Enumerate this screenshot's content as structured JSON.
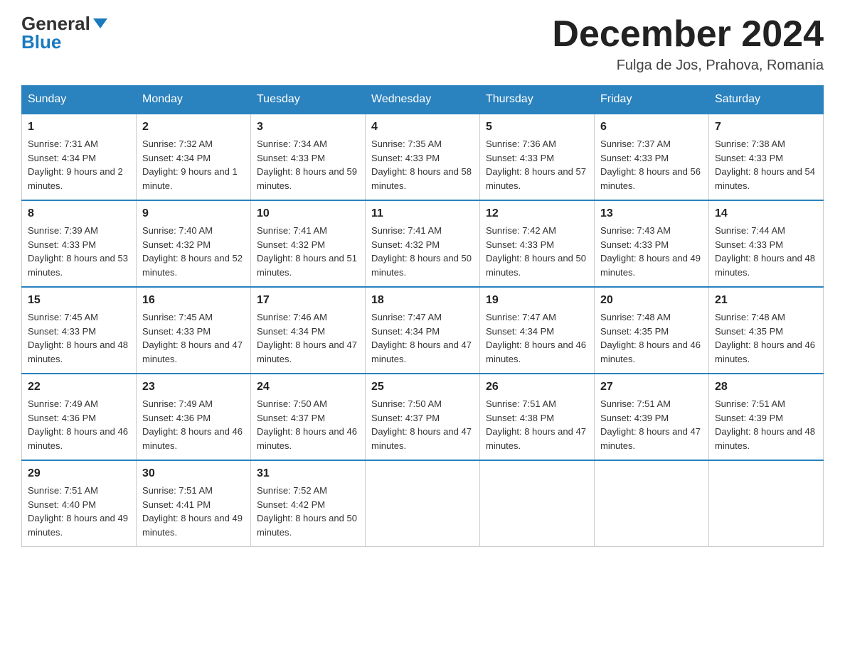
{
  "header": {
    "logo_general": "General",
    "logo_blue": "Blue",
    "month_title": "December 2024",
    "location": "Fulga de Jos, Prahova, Romania"
  },
  "days_of_week": [
    "Sunday",
    "Monday",
    "Tuesday",
    "Wednesday",
    "Thursday",
    "Friday",
    "Saturday"
  ],
  "weeks": [
    [
      {
        "day": "1",
        "sunrise": "7:31 AM",
        "sunset": "4:34 PM",
        "daylight": "9 hours and 2 minutes."
      },
      {
        "day": "2",
        "sunrise": "7:32 AM",
        "sunset": "4:34 PM",
        "daylight": "9 hours and 1 minute."
      },
      {
        "day": "3",
        "sunrise": "7:34 AM",
        "sunset": "4:33 PM",
        "daylight": "8 hours and 59 minutes."
      },
      {
        "day": "4",
        "sunrise": "7:35 AM",
        "sunset": "4:33 PM",
        "daylight": "8 hours and 58 minutes."
      },
      {
        "day": "5",
        "sunrise": "7:36 AM",
        "sunset": "4:33 PM",
        "daylight": "8 hours and 57 minutes."
      },
      {
        "day": "6",
        "sunrise": "7:37 AM",
        "sunset": "4:33 PM",
        "daylight": "8 hours and 56 minutes."
      },
      {
        "day": "7",
        "sunrise": "7:38 AM",
        "sunset": "4:33 PM",
        "daylight": "8 hours and 54 minutes."
      }
    ],
    [
      {
        "day": "8",
        "sunrise": "7:39 AM",
        "sunset": "4:33 PM",
        "daylight": "8 hours and 53 minutes."
      },
      {
        "day": "9",
        "sunrise": "7:40 AM",
        "sunset": "4:32 PM",
        "daylight": "8 hours and 52 minutes."
      },
      {
        "day": "10",
        "sunrise": "7:41 AM",
        "sunset": "4:32 PM",
        "daylight": "8 hours and 51 minutes."
      },
      {
        "day": "11",
        "sunrise": "7:41 AM",
        "sunset": "4:32 PM",
        "daylight": "8 hours and 50 minutes."
      },
      {
        "day": "12",
        "sunrise": "7:42 AM",
        "sunset": "4:33 PM",
        "daylight": "8 hours and 50 minutes."
      },
      {
        "day": "13",
        "sunrise": "7:43 AM",
        "sunset": "4:33 PM",
        "daylight": "8 hours and 49 minutes."
      },
      {
        "day": "14",
        "sunrise": "7:44 AM",
        "sunset": "4:33 PM",
        "daylight": "8 hours and 48 minutes."
      }
    ],
    [
      {
        "day": "15",
        "sunrise": "7:45 AM",
        "sunset": "4:33 PM",
        "daylight": "8 hours and 48 minutes."
      },
      {
        "day": "16",
        "sunrise": "7:45 AM",
        "sunset": "4:33 PM",
        "daylight": "8 hours and 47 minutes."
      },
      {
        "day": "17",
        "sunrise": "7:46 AM",
        "sunset": "4:34 PM",
        "daylight": "8 hours and 47 minutes."
      },
      {
        "day": "18",
        "sunrise": "7:47 AM",
        "sunset": "4:34 PM",
        "daylight": "8 hours and 47 minutes."
      },
      {
        "day": "19",
        "sunrise": "7:47 AM",
        "sunset": "4:34 PM",
        "daylight": "8 hours and 46 minutes."
      },
      {
        "day": "20",
        "sunrise": "7:48 AM",
        "sunset": "4:35 PM",
        "daylight": "8 hours and 46 minutes."
      },
      {
        "day": "21",
        "sunrise": "7:48 AM",
        "sunset": "4:35 PM",
        "daylight": "8 hours and 46 minutes."
      }
    ],
    [
      {
        "day": "22",
        "sunrise": "7:49 AM",
        "sunset": "4:36 PM",
        "daylight": "8 hours and 46 minutes."
      },
      {
        "day": "23",
        "sunrise": "7:49 AM",
        "sunset": "4:36 PM",
        "daylight": "8 hours and 46 minutes."
      },
      {
        "day": "24",
        "sunrise": "7:50 AM",
        "sunset": "4:37 PM",
        "daylight": "8 hours and 46 minutes."
      },
      {
        "day": "25",
        "sunrise": "7:50 AM",
        "sunset": "4:37 PM",
        "daylight": "8 hours and 47 minutes."
      },
      {
        "day": "26",
        "sunrise": "7:51 AM",
        "sunset": "4:38 PM",
        "daylight": "8 hours and 47 minutes."
      },
      {
        "day": "27",
        "sunrise": "7:51 AM",
        "sunset": "4:39 PM",
        "daylight": "8 hours and 47 minutes."
      },
      {
        "day": "28",
        "sunrise": "7:51 AM",
        "sunset": "4:39 PM",
        "daylight": "8 hours and 48 minutes."
      }
    ],
    [
      {
        "day": "29",
        "sunrise": "7:51 AM",
        "sunset": "4:40 PM",
        "daylight": "8 hours and 49 minutes."
      },
      {
        "day": "30",
        "sunrise": "7:51 AM",
        "sunset": "4:41 PM",
        "daylight": "8 hours and 49 minutes."
      },
      {
        "day": "31",
        "sunrise": "7:52 AM",
        "sunset": "4:42 PM",
        "daylight": "8 hours and 50 minutes."
      },
      null,
      null,
      null,
      null
    ]
  ],
  "labels": {
    "sunrise": "Sunrise:",
    "sunset": "Sunset:",
    "daylight": "Daylight:"
  }
}
